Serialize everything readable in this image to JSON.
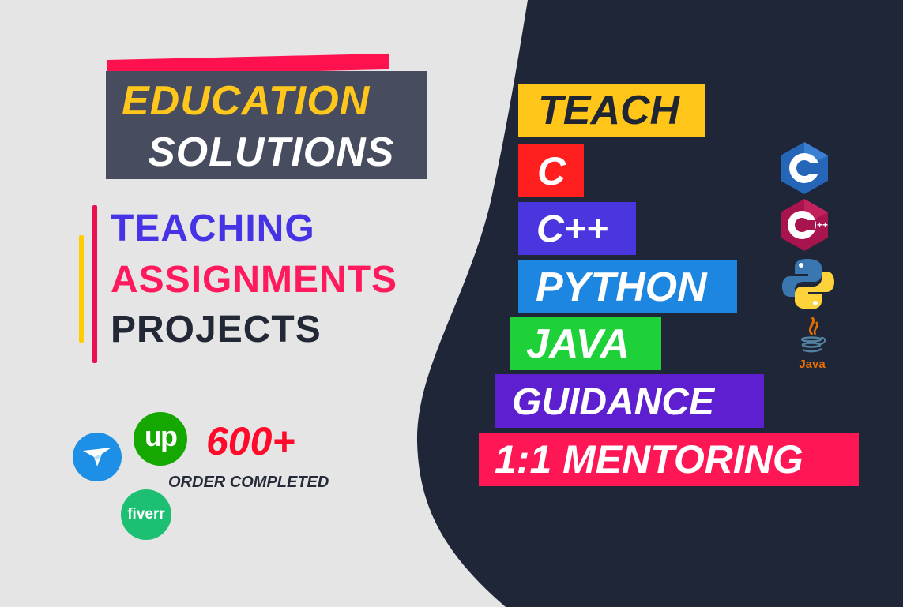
{
  "headline": {
    "line1": "EDUCATION",
    "line2": "SOLUTIONS"
  },
  "services": [
    "TEACHING",
    "ASSIGNMENTS",
    "PROJECTS"
  ],
  "stats": {
    "count": "600+",
    "label": "ORDER COMPLETED"
  },
  "platforms": {
    "upwork_text": "up",
    "fiverr_text": "fiverr"
  },
  "topics": {
    "teach": "TEACH",
    "c": "C",
    "cpp": "C++",
    "python": "PYTHON",
    "java": "JAVA",
    "guidance": "GUIDANCE",
    "mentoring": "1:1 MENTORING"
  },
  "icons": {
    "c_icon_text": "C",
    "cpp_icon_text": "++",
    "java_icon_text": "Java"
  },
  "colors": {
    "background_light": "#e5e5e5",
    "background_dark": "#1e2638",
    "yellow": "#ffc619",
    "red": "#ff1f1f",
    "blue_purple": "#4a35df",
    "blue": "#1c86e0",
    "green": "#1ed138",
    "purple": "#5e1fd0",
    "pink": "#ff1655"
  }
}
